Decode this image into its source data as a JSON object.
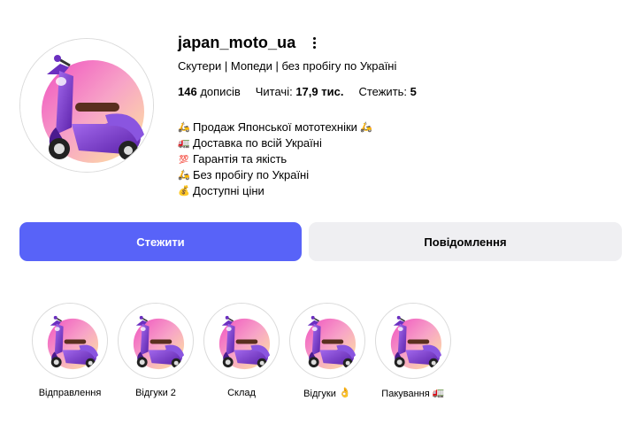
{
  "profile": {
    "username": "japan_moto_ua",
    "category": "Скутери | Мопеди | без пробігу по Україні",
    "stats": {
      "posts_value": "146",
      "posts_label": "дописів",
      "followers_label": "Читачі:",
      "followers_value": "17,9 тис.",
      "following_label": "Стежить:",
      "following_value": "5"
    },
    "bio": [
      {
        "icon": "scooter-emoji",
        "text": "Продаж Японської мототехніки",
        "trail_icon": "scooter-emoji"
      },
      {
        "icon": "truck-emoji",
        "text": "Доставка по всій Україні"
      },
      {
        "icon": "hundred-points-emoji",
        "text": "Гарантія та якість"
      },
      {
        "icon": "scooter-emoji",
        "text": "Без пробігу по Україні"
      },
      {
        "icon": "money-bag-emoji",
        "text": "Доступні ціни"
      }
    ]
  },
  "actions": {
    "follow_label": "Стежити",
    "message_label": "Повідомлення"
  },
  "highlights": [
    {
      "label": "Відправлення"
    },
    {
      "label": "Відгуки 2"
    },
    {
      "label": "Склад"
    },
    {
      "label": "Відгуки",
      "icon": "ok-hand-emoji"
    },
    {
      "label": "Пакування",
      "icon": "truck-emoji"
    }
  ],
  "colors": {
    "follow_button": "#5863f8",
    "message_button": "#efeff2",
    "scooter": "#7b3fd1",
    "gradient_pink": "#f48ac6",
    "gradient_yellow": "#ffe08a"
  }
}
